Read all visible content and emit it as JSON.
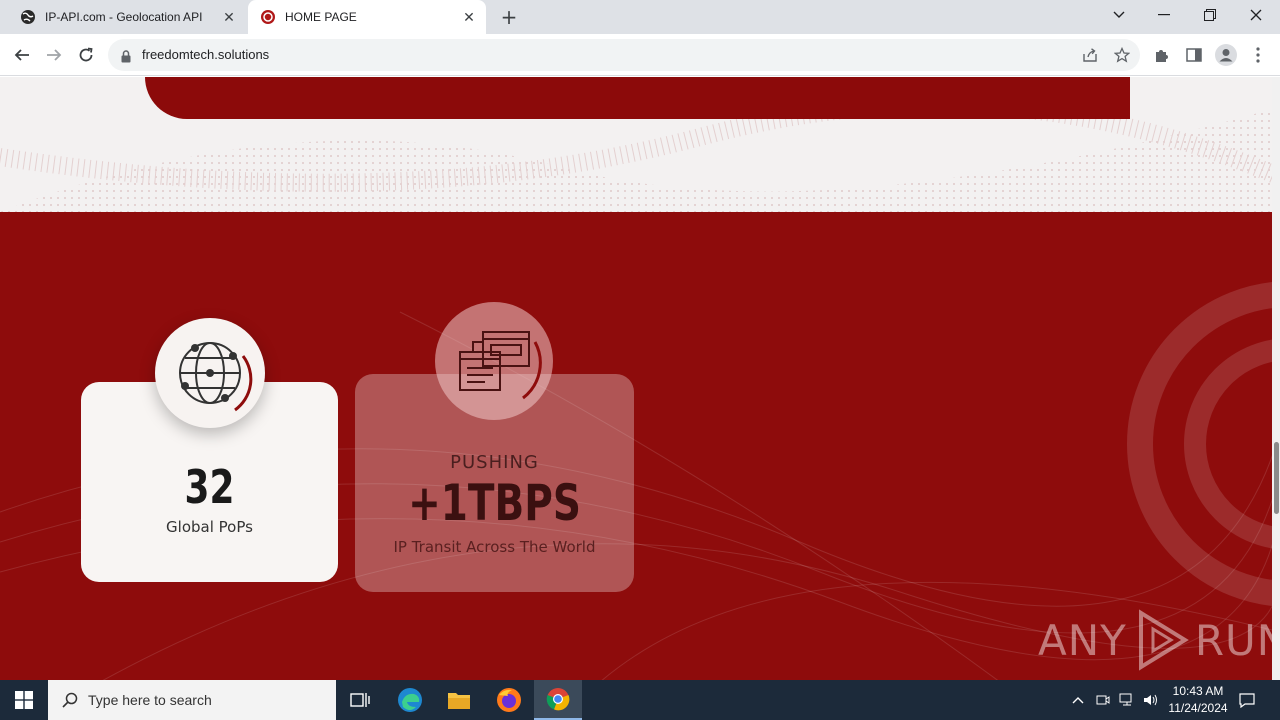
{
  "browser": {
    "tabs": [
      {
        "title": "IP-API.com - Geolocation API",
        "favicon": "globe-map-icon"
      },
      {
        "title": "HOME PAGE",
        "favicon": "red-circle-icon",
        "active": true
      }
    ],
    "url": "freedomtech.solutions"
  },
  "page": {
    "stats": [
      {
        "number": "32",
        "caption": "Global PoPs",
        "icon": "globe-network-icon"
      },
      {
        "pre": "PUSHING",
        "number": "+1TBPS",
        "caption": "IP Transit Across The World",
        "icon": "browser-windows-icon"
      }
    ],
    "watermark": {
      "left": "ANY",
      "right": "RUN"
    },
    "colors": {
      "primary_red": "#8e0c0c",
      "card_light": "#f8f5f3",
      "text_dark": "#1a1a1a"
    }
  },
  "taskbar": {
    "search_placeholder": "Type here to search",
    "time": "10:43 AM",
    "date": "11/24/2024"
  }
}
